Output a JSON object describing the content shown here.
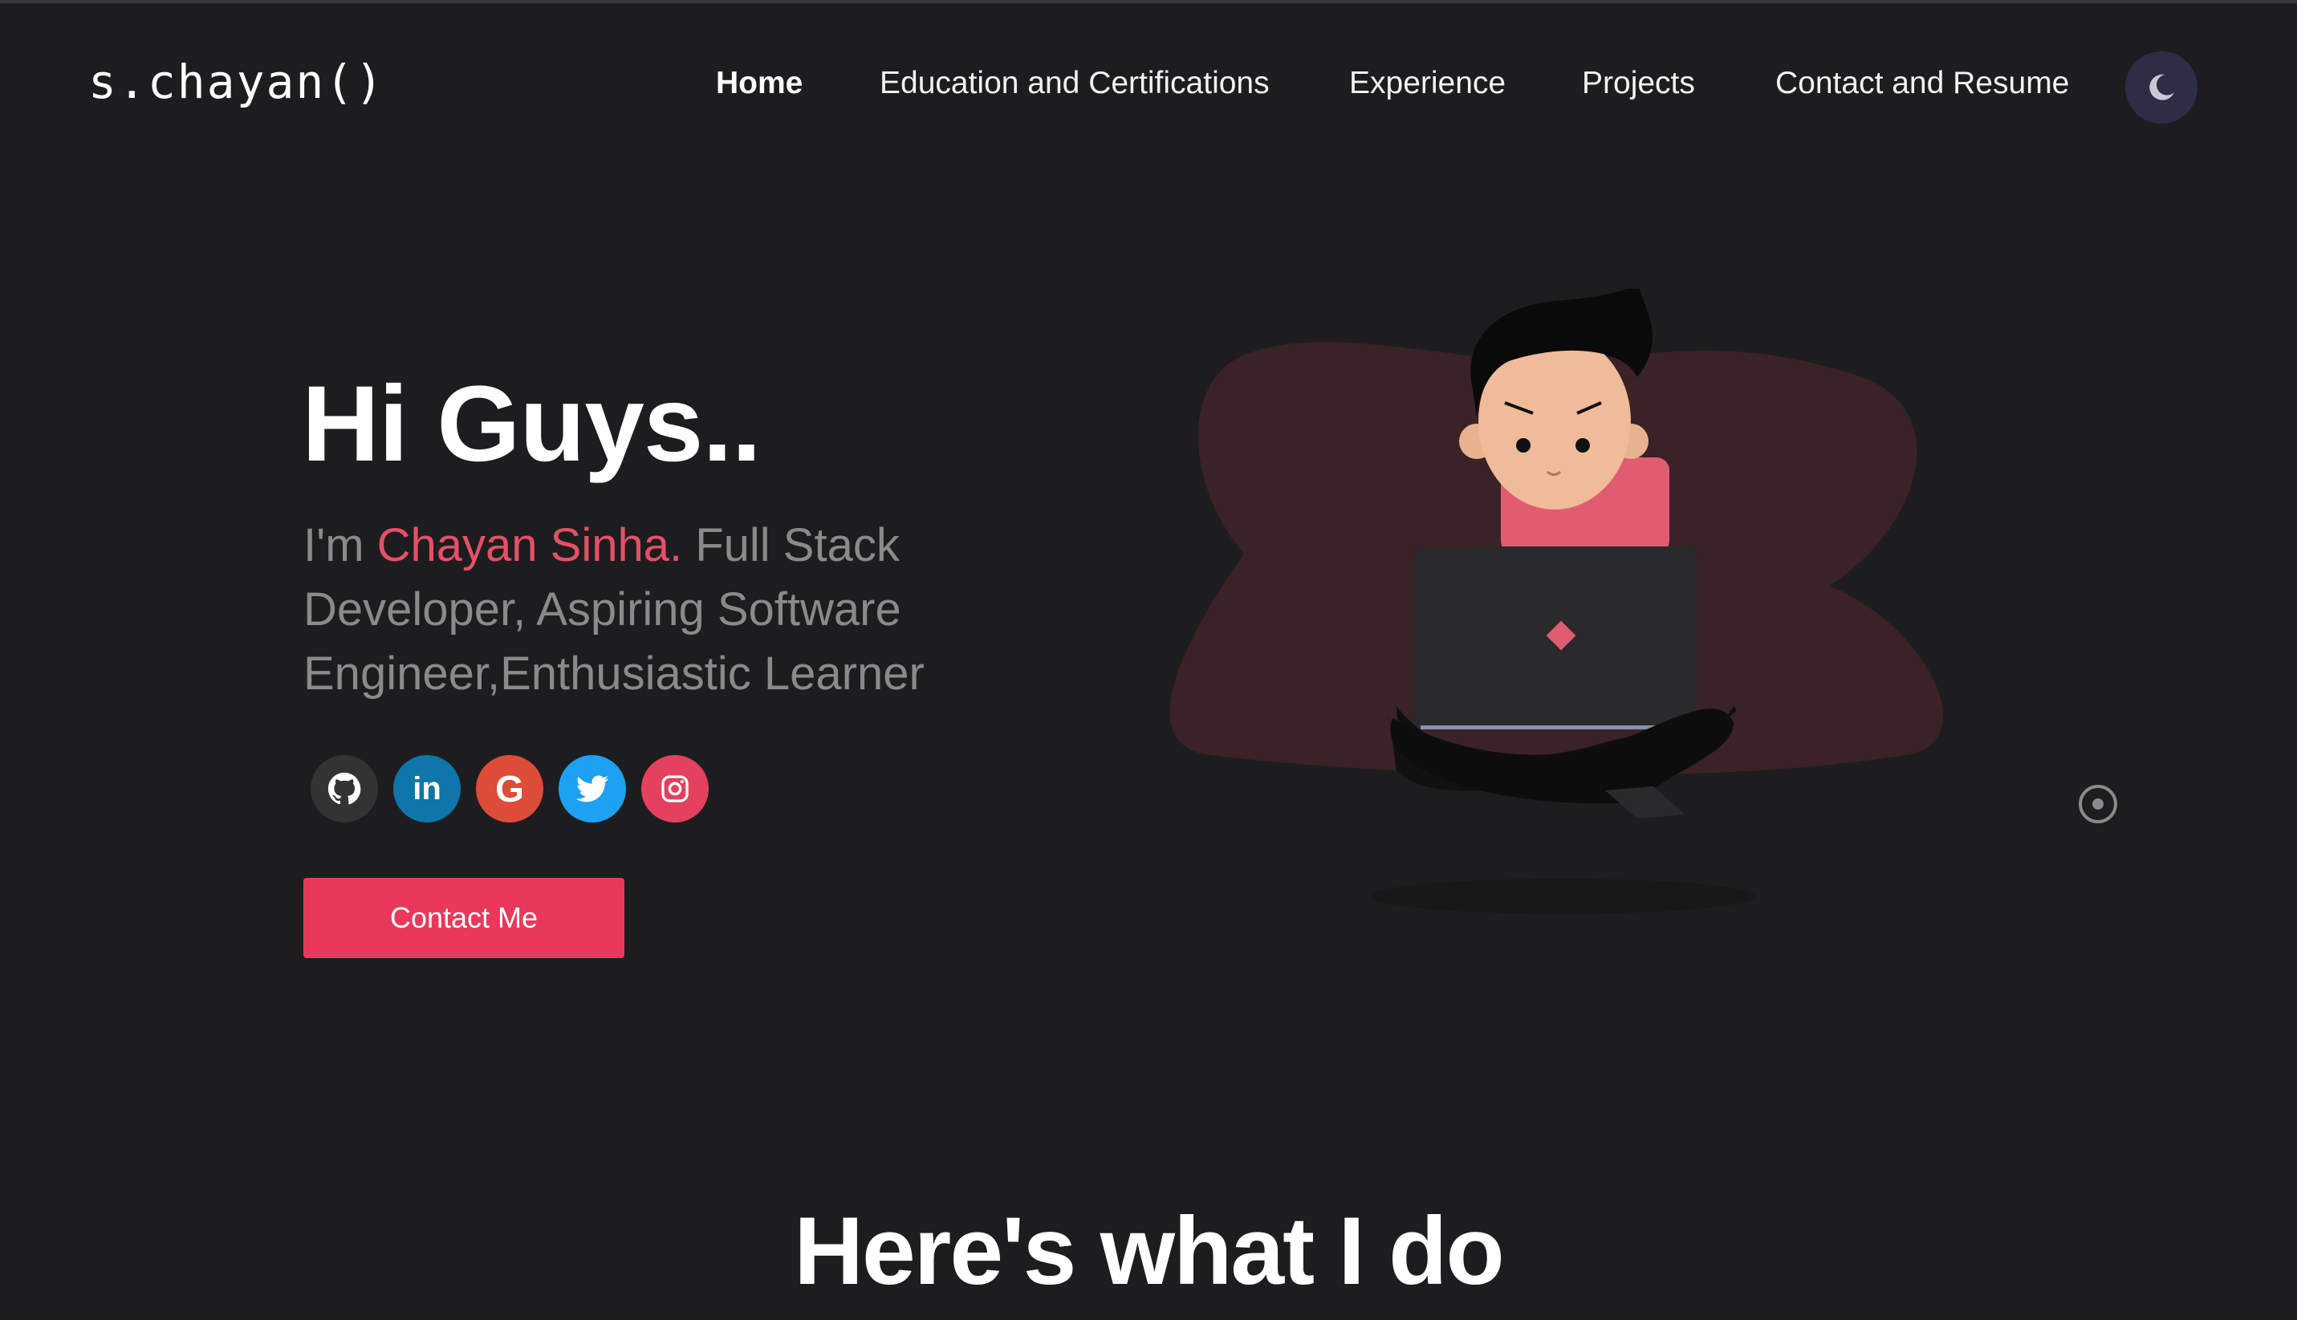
{
  "header": {
    "logo": "s.chayan()",
    "nav": [
      {
        "label": "Home",
        "active": true
      },
      {
        "label": "Education and Certifications",
        "active": false
      },
      {
        "label": "Experience",
        "active": false
      },
      {
        "label": "Projects",
        "active": false
      },
      {
        "label": "Contact and Resume",
        "active": false
      }
    ],
    "theme_toggle_icon": "moon-icon"
  },
  "hero": {
    "greeting": "Hi Guys..",
    "intro_prefix": "I'm ",
    "name": "Chayan Sinha.",
    "intro_suffix": " Full Stack Developer, Aspiring Software Engineer,Enthusiastic Learner",
    "socials": [
      {
        "icon": "github-icon",
        "color": "#333333"
      },
      {
        "icon": "linkedin-icon",
        "color": "#0e76a8"
      },
      {
        "icon": "google-icon",
        "color": "#dd4b39"
      },
      {
        "icon": "twitter-icon",
        "color": "#1da1f2"
      },
      {
        "icon": "instagram-icon",
        "color": "#e4405f"
      }
    ],
    "contact_button": "Contact Me"
  },
  "section": {
    "title": "Here's what I do"
  },
  "colors": {
    "background": "#1d1d1f",
    "accent": "#e8395a",
    "name_highlight": "#e55066",
    "toggle_bg": "#2d2e46"
  }
}
